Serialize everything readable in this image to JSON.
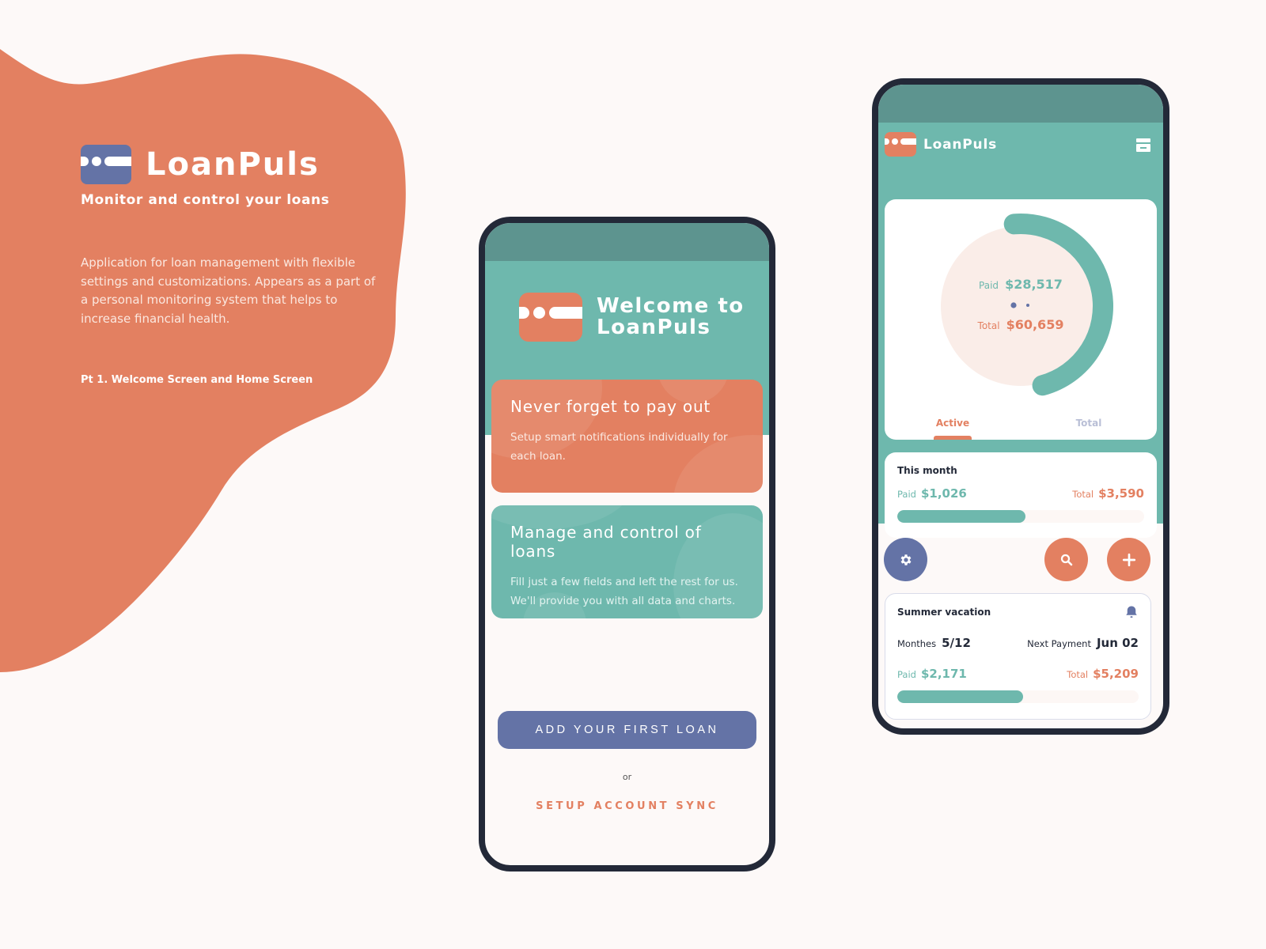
{
  "colors": {
    "orange": "#e38061",
    "teal": "#6eb8ad",
    "teal_dark": "#5d948f",
    "indigo": "#6473a6",
    "frame": "#232938",
    "background": "#fdf9f8"
  },
  "intro": {
    "brand_name": "LoanPuls",
    "tagline": "Monitor and control your loans",
    "description": "Application for loan management with flexible settings and customizations. Appears as a part of a personal monitoring system that helps to increase financial health.",
    "part_label": "Pt 1. Welcome Screen and Home Screen",
    "logo_icon": "card-logo-icon"
  },
  "welcome_screen": {
    "title_line1": "Welcome to",
    "title_line2": "LoanPuls",
    "features": [
      {
        "title": "Never forget to pay out",
        "text": "Setup smart notifications individually for each loan."
      },
      {
        "title": "Manage and control of loans",
        "text": "Fill just a few fields and left the rest for us. We'll provide you with all data and charts."
      }
    ],
    "primary_button": "ADD YOUR FIRST LOAN",
    "or_label": "or",
    "secondary_button": "SETUP ACCOUNT SYNC"
  },
  "home_screen": {
    "app_title": "LoanPuls",
    "menu_icon": "archive-menu-icon",
    "summary": {
      "paid_label": "Paid",
      "paid_value": "$28,517",
      "total_label": "Total",
      "total_value": "$60,659",
      "paid_fraction": 0.47,
      "pager_dots": 2,
      "pager_active": 0
    },
    "tabs": [
      {
        "label": "Active",
        "active": true
      },
      {
        "label": "Total",
        "active": false
      }
    ],
    "this_month": {
      "title": "This month",
      "paid_label": "Paid",
      "paid_value": "$1,026",
      "total_label": "Total",
      "total_value": "$3,590",
      "progress_percent": 52
    },
    "actions": [
      {
        "name": "settings",
        "icon": "gear-icon"
      },
      {
        "name": "search",
        "icon": "search-icon"
      },
      {
        "name": "add",
        "icon": "plus-icon"
      }
    ],
    "loan": {
      "title": "Summer vacation",
      "bell_icon": "bell-icon",
      "months_label": "Monthes",
      "months_value": "5/12",
      "next_label": "Next Payment",
      "next_value": "Jun 02",
      "paid_label": "Paid",
      "paid_value": "$2,171",
      "total_label": "Total",
      "total_value": "$5,209",
      "progress_percent": 52
    }
  }
}
